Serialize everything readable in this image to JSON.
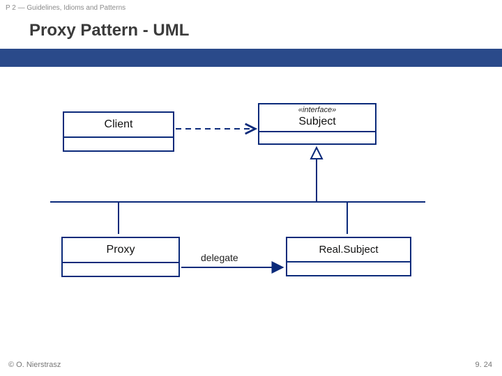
{
  "breadcrumb": "P 2 — Guidelines, Idioms and Patterns",
  "title": "Proxy Pattern - UML",
  "boxes": {
    "client": {
      "name": "Client"
    },
    "subject": {
      "stereotype": "«interface»",
      "name": "Subject"
    },
    "proxy": {
      "name": "Proxy"
    },
    "real": {
      "name": "Real.Subject"
    }
  },
  "labels": {
    "delegate": "delegate"
  },
  "footer": {
    "copyright": "© O. Nierstrasz",
    "page": "9. 24"
  },
  "colors": {
    "band": "#2a4a8a",
    "umlBorder": "#0b2a7a"
  }
}
